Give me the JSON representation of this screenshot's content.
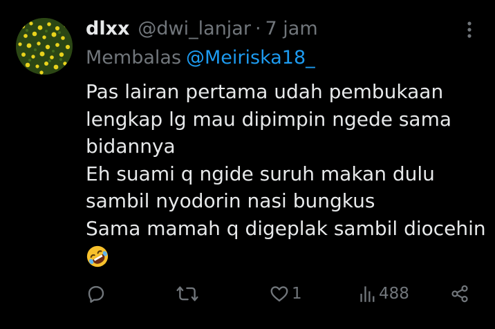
{
  "tweet": {
    "display_name": "dlxx",
    "handle": "@dwi_lanjar",
    "separator": "·",
    "time": "7 jam",
    "reply_label": "Membalas",
    "reply_to": "@Meiriska18_",
    "body_lines": [
      "Pas lairan pertama udah pembukaan",
      "lengkap lg mau dipimpin ngede sama",
      "bidannya",
      "Eh suami q ngide suruh makan dulu",
      "sambil nyodorin nasi bungkus",
      "Sama mamah q digeplak sambil diocehin"
    ],
    "emoji": "rolling-on-floor-laughing-emoji"
  },
  "actions": {
    "reply": {
      "icon": "reply-icon",
      "count": ""
    },
    "retweet": {
      "icon": "retweet-icon",
      "count": ""
    },
    "like": {
      "icon": "heart-icon",
      "count": "1"
    },
    "views": {
      "icon": "views-icon",
      "count": "488"
    },
    "share": {
      "icon": "share-icon",
      "count": ""
    }
  },
  "colors": {
    "background": "#000000",
    "text": "#e7e9ea",
    "muted": "#71767b",
    "link": "#1d9bf0"
  }
}
